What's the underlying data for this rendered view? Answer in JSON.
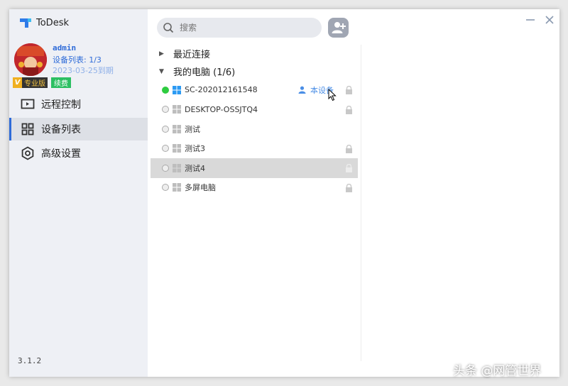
{
  "app": {
    "name": "ToDesk",
    "version": "3.1.2"
  },
  "user": {
    "name": "admin",
    "device_count": "设备列表: 1/3",
    "expire": "2023-03-25到期",
    "badge_pro": "专业版",
    "badge_pro_mark": "V",
    "badge_renew": "续费"
  },
  "nav": [
    {
      "label": "远程控制",
      "icon": "monitor-icon"
    },
    {
      "label": "设备列表",
      "icon": "grid-icon"
    },
    {
      "label": "高级设置",
      "icon": "gear-icon"
    }
  ],
  "active_nav": "设备列表",
  "search": {
    "placeholder": "搜索"
  },
  "groups": [
    {
      "label": "最近连接",
      "collapsed": true
    },
    {
      "label": "我的电脑 (1/6)",
      "collapsed": false
    }
  ],
  "devices": [
    {
      "name": "SC-202012161548",
      "online": true,
      "this_device": "本设备",
      "locked": true
    },
    {
      "name": "DESKTOP-OSSJTQ4",
      "online": false,
      "locked": true
    },
    {
      "name": "测试",
      "online": false,
      "locked": false
    },
    {
      "name": "测试3",
      "online": false,
      "locked": true
    },
    {
      "name": "测试4",
      "online": false,
      "locked": true,
      "selected": true
    },
    {
      "name": "多屏电脑",
      "online": false,
      "locked": true
    }
  ],
  "watermark": "头条 @网管世界",
  "colors": {
    "accent": "#2e6bd8",
    "online": "#2ecc40",
    "renew": "#2bbf62",
    "sidebar": "#eef0f5"
  }
}
